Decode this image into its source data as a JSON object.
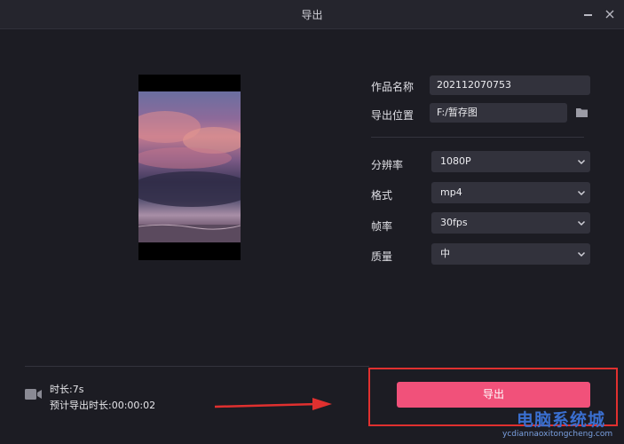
{
  "window": {
    "title": "导出"
  },
  "form": {
    "name_label": "作品名称",
    "name_value": "202112070753",
    "location_label": "导出位置",
    "location_value": "F:/暂存图",
    "resolution_label": "分辨率",
    "resolution_value": "1080P",
    "format_label": "格式",
    "format_value": "mp4",
    "fps_label": "帧率",
    "fps_value": "30fps",
    "quality_label": "质量",
    "quality_value": "中"
  },
  "footer": {
    "duration": "时长:7s",
    "estimate": "预计导出时长:00:00:02",
    "export_label": "导出"
  },
  "watermark": {
    "text": "电脑系统城",
    "url": "ycdiannaoxitongcheng.com"
  }
}
